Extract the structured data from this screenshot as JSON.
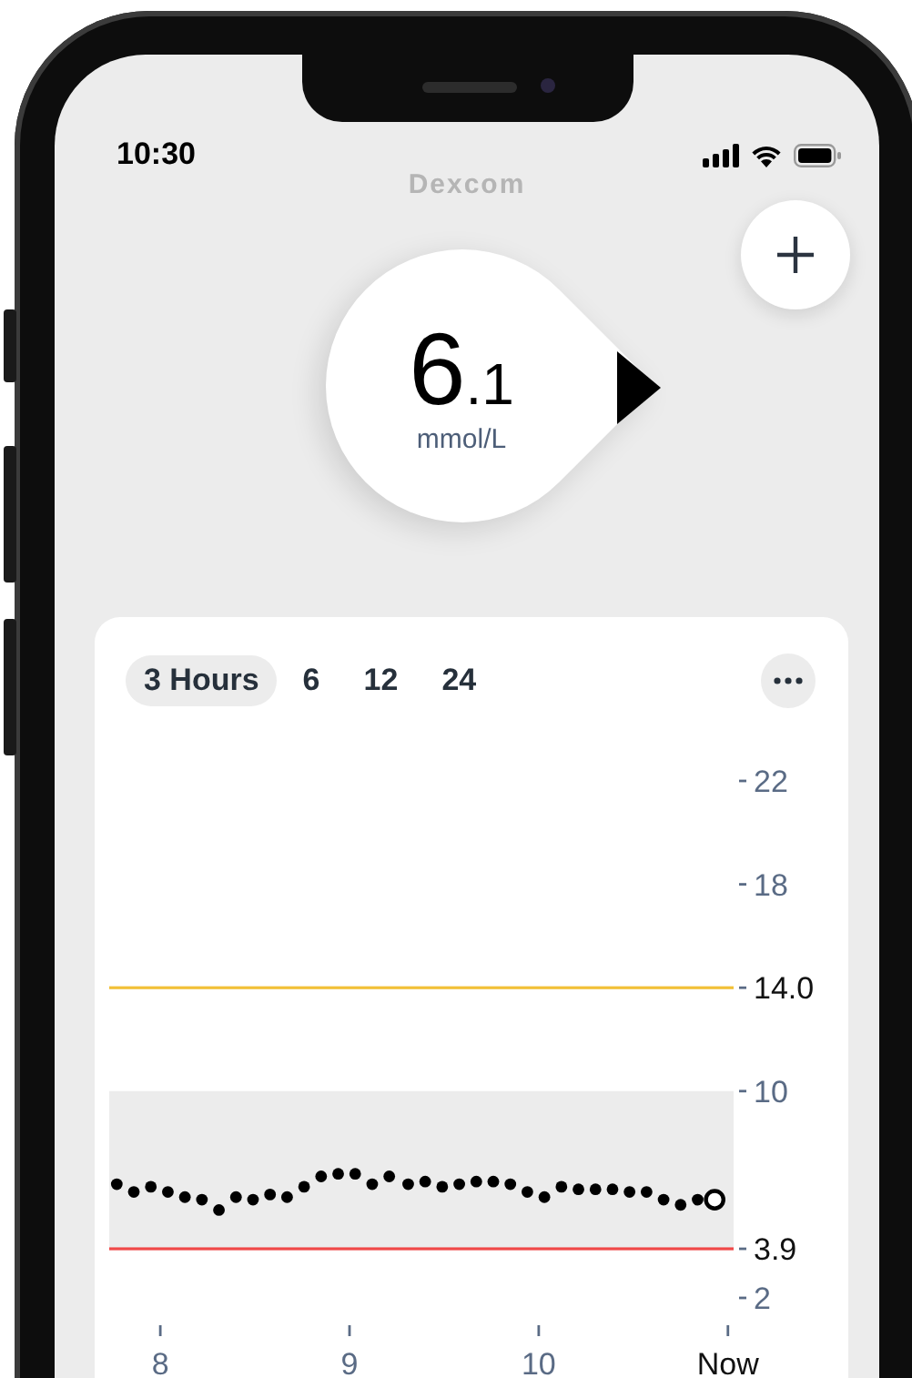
{
  "status_bar": {
    "time": "10:30"
  },
  "brand": "Dexcom",
  "reading": {
    "value": "6.1",
    "unit": "mmol/L"
  },
  "chart_card": {
    "ranges": [
      {
        "label": "3 Hours",
        "selected": true
      },
      {
        "label": "6",
        "selected": false
      },
      {
        "label": "12",
        "selected": false
      },
      {
        "label": "24",
        "selected": false
      }
    ],
    "chart_data": {
      "type": "scatter",
      "x": [
        7.77,
        7.86,
        7.95,
        8.04,
        8.13,
        8.22,
        8.31,
        8.4,
        8.49,
        8.58,
        8.67,
        8.76,
        8.85,
        8.94,
        9.03,
        9.12,
        9.21,
        9.31,
        9.4,
        9.49,
        9.58,
        9.67,
        9.76,
        9.85,
        9.94,
        10.03,
        10.12,
        10.21,
        10.3,
        10.39,
        10.48,
        10.57,
        10.66,
        10.75,
        10.84,
        10.93
      ],
      "series": [
        {
          "color": "#000000",
          "values": [
            6.4,
            6.1,
            6.3,
            6.1,
            5.9,
            5.8,
            5.4,
            5.9,
            5.8,
            6.0,
            5.9,
            6.3,
            6.7,
            6.8,
            6.8,
            6.4,
            6.7,
            6.4,
            6.5,
            6.3,
            6.4,
            6.5,
            6.5,
            6.4,
            6.1,
            5.9,
            6.3,
            6.2,
            6.2,
            6.2,
            6.1,
            6.1,
            5.8,
            5.6,
            5.8,
            null
          ]
        },
        {
          "color": "#000000",
          "values": [
            null,
            null,
            null,
            null,
            null,
            null,
            null,
            null,
            null,
            null,
            null,
            null,
            null,
            null,
            null,
            null,
            null,
            null,
            null,
            null,
            null,
            null,
            null,
            null,
            null,
            null,
            null,
            null,
            null,
            null,
            null,
            null,
            null,
            null,
            null,
            5.8
          ]
        }
      ],
      "xlim": [
        7.73,
        11.03
      ],
      "ylim": [
        2,
        22
      ],
      "xticks": [
        8,
        9,
        10,
        {
          "value": 11,
          "label": "Now"
        }
      ],
      "yticks": [
        22,
        18,
        {
          "value": 14,
          "label": "14.0"
        },
        10,
        {
          "value": 3.9,
          "label": "3.9"
        },
        2
      ],
      "bands": [
        {
          "axis": "y",
          "from": 3.9,
          "to": 10,
          "color": "#ececec"
        }
      ],
      "ref_lines": [
        {
          "axis": "y",
          "value": 14,
          "color": "#f2c037"
        },
        {
          "axis": "y",
          "value": 3.9,
          "color": "#f04848"
        }
      ]
    }
  }
}
